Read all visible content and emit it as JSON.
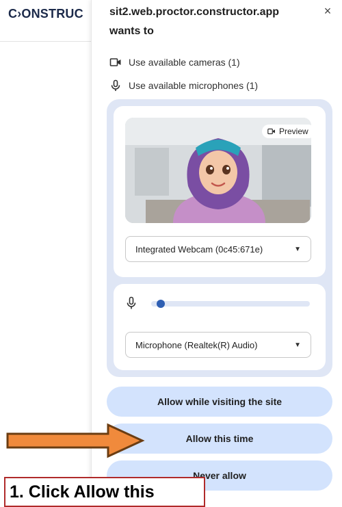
{
  "page": {
    "brand": "C›ONSTRUC"
  },
  "dialog": {
    "origin": "sit2.web.proctor.constructor.app",
    "wants_to": "wants to",
    "close_symbol": "×",
    "permissions": [
      {
        "icon": "camera-icon",
        "label": "Use available cameras (1)"
      },
      {
        "icon": "microphone-icon",
        "label": "Use available microphones (1)"
      }
    ],
    "camera": {
      "preview_label": "Preview",
      "selected_device": "Integrated Webcam (0c45:671e)"
    },
    "microphone": {
      "selected_device": "Microphone (Realtek(R) Audio)",
      "level": 0.05
    },
    "buttons": {
      "allow_site": "Allow while visiting the site",
      "allow_once": "Allow this time",
      "never": "Never allow"
    }
  },
  "tutorial": {
    "callout": "1. Click Allow this"
  },
  "colors": {
    "panel_bg": "#dfe6f5",
    "button_bg": "#d3e3fd",
    "accent": "#2f5fb3",
    "arrow_fill": "#f08a3c",
    "arrow_stroke": "#6b3d12",
    "callout_border": "#b02a2a"
  }
}
